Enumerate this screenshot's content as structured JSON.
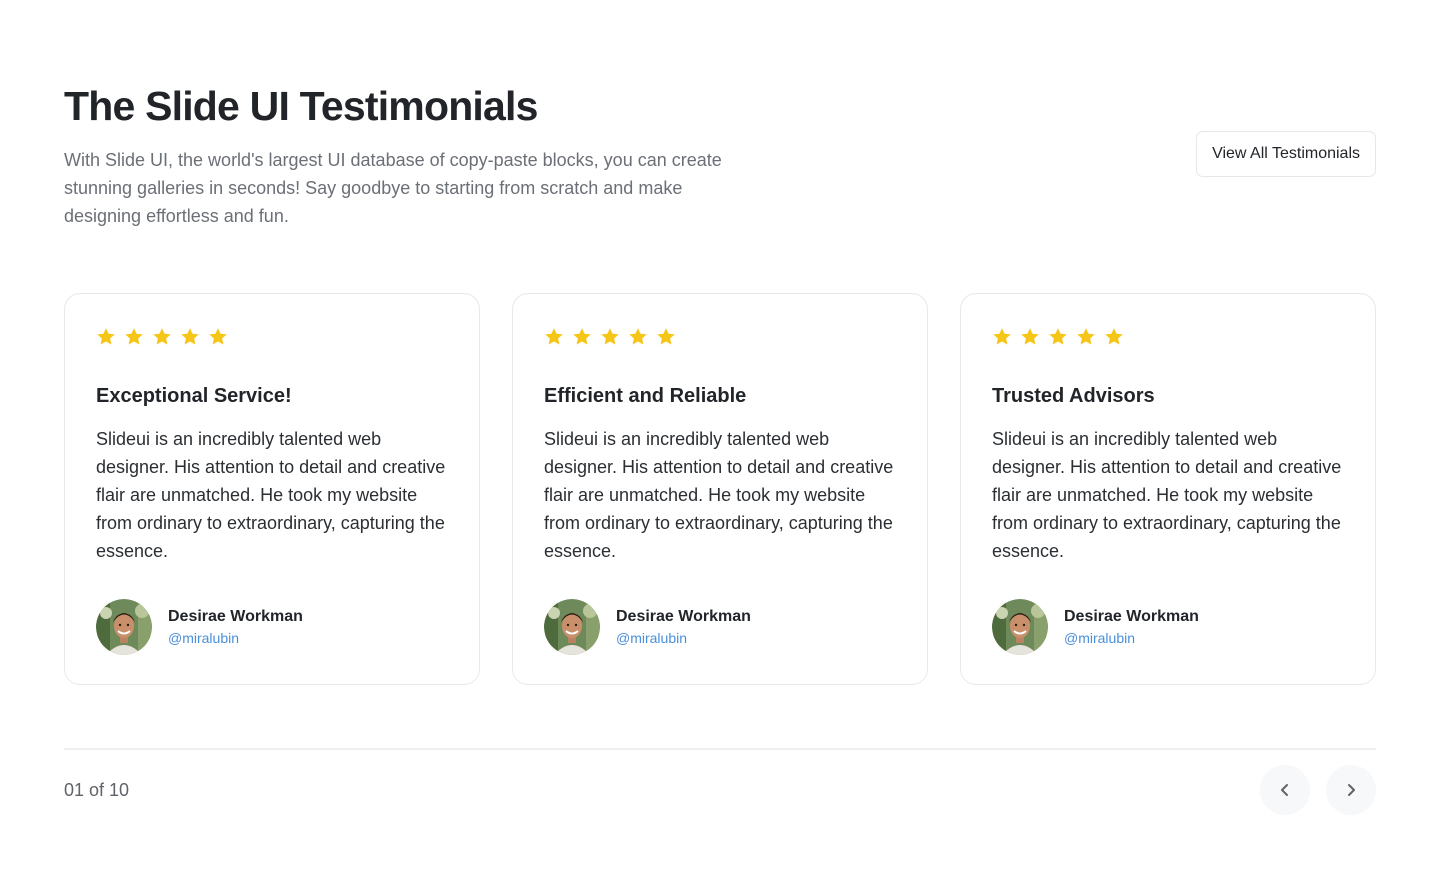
{
  "header": {
    "title": "The Slide UI Testimonials",
    "subtitle": "With Slide UI, the world's largest UI database of copy-paste blocks, you can create stunning galleries in seconds! Say goodbye to starting from scratch and make designing effortless and fun.",
    "view_all_label": "View All Testimonials"
  },
  "colors": {
    "star": "#f5c518",
    "handle": "#4a90d9",
    "border": "#e7e8ea"
  },
  "cards": [
    {
      "rating": 5,
      "title": "Exceptional Service!",
      "body": "Slideui is an incredibly talented web designer. His attention to detail and creative flair are unmatched. He took my website from ordinary to extraordinary, capturing the essence.",
      "author_name": "Desirae Workman",
      "author_handle": "@miralubin"
    },
    {
      "rating": 5,
      "title": "Efficient and Reliable",
      "body": "Slideui is an incredibly talented web designer. His attention to detail and creative flair are unmatched. He took my website from ordinary to extraordinary, capturing the essence.",
      "author_name": "Desirae Workman",
      "author_handle": "@miralubin"
    },
    {
      "rating": 5,
      "title": "Trusted Advisors",
      "body": "Slideui is an incredibly talented web designer. His attention to detail and creative flair are unmatched. He took my website from ordinary to extraordinary, capturing the essence.",
      "author_name": "Desirae Workman",
      "author_handle": "@miralubin"
    }
  ],
  "pagination": {
    "status": "01 of 10",
    "prev_icon": "chevron-left-icon",
    "next_icon": "chevron-right-icon"
  }
}
